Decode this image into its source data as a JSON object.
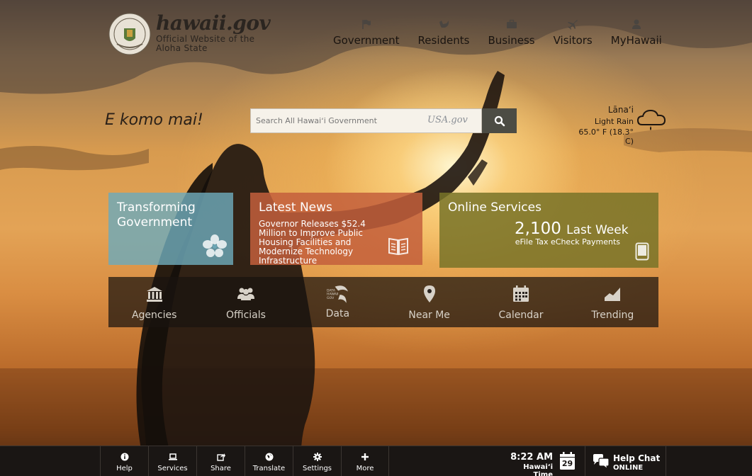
{
  "brand": {
    "name": "hawaii.gov",
    "tagline": "Official Website of the Aloha State",
    "seal_text": "STATE OF HAWAII"
  },
  "topnav": [
    {
      "label": "Government",
      "icon": "flag-icon"
    },
    {
      "label": "Residents",
      "icon": "shaka-hand-icon"
    },
    {
      "label": "Business",
      "icon": "briefcase-icon"
    },
    {
      "label": "Visitors",
      "icon": "airplane-icon"
    },
    {
      "label": "MyHawaii",
      "icon": "user-icon"
    }
  ],
  "welcome": "E komo mai!",
  "search": {
    "placeholder": "Search All Hawaiʻi Government",
    "provider": "USA.gov"
  },
  "weather": {
    "location": "Lānaʻi",
    "description": "Light Rain",
    "temperature": "65.0° F (18.3° C)",
    "icon": "rain-cloud-icon"
  },
  "tiles": {
    "transforming": {
      "title": "Transforming Government",
      "icon": "hibiscus-icon"
    },
    "news": {
      "title": "Latest News",
      "headline": "Governor Releases $52.4 Million to Improve Public Housing Facilities and Modernize Technology Infrastructure",
      "icon": "open-book-icon"
    },
    "online": {
      "title": "Online Services",
      "count": "2,100",
      "count_suffix": "Last Week",
      "subtitle": "eFile Tax eCheck Payments",
      "icon": "tablet-icon"
    }
  },
  "quicklinks": [
    {
      "label": "Agencies",
      "icon": "building-icon"
    },
    {
      "label": "Officials",
      "icon": "people-icon"
    },
    {
      "label": "Data",
      "icon": "data-hawaii-icon",
      "icon_text": "DATA HAWAII GOV"
    },
    {
      "label": "Near Me",
      "icon": "map-pin-icon"
    },
    {
      "label": "Calendar",
      "icon": "calendar-icon"
    },
    {
      "label": "Trending",
      "icon": "trending-icon"
    }
  ],
  "toolbar": [
    {
      "label": "Help",
      "icon": "info-icon"
    },
    {
      "label": "Services",
      "icon": "laptop-icon"
    },
    {
      "label": "Share",
      "icon": "share-icon"
    },
    {
      "label": "Translate",
      "icon": "globe-icon"
    },
    {
      "label": "Settings",
      "icon": "gear-icon"
    },
    {
      "label": "More",
      "icon": "plus-icon"
    }
  ],
  "clock": {
    "time": "8:22 AM",
    "zone": "Hawaiʻi Time",
    "day": "29"
  },
  "help_chat": {
    "title": "Help Chat",
    "status": "ONLINE"
  },
  "colors": {
    "tile_transform": "#6eaab9",
    "tile_news": "#c35f3c",
    "tile_online": "#787328",
    "toolbar_bg": "#1a1614"
  }
}
